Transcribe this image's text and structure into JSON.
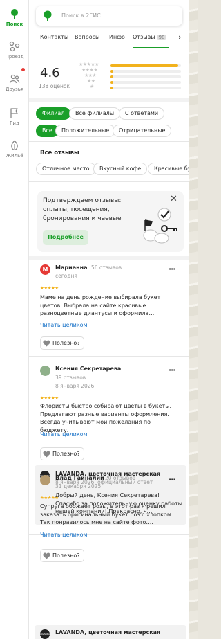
{
  "rail": {
    "items": [
      {
        "label": "Поиск",
        "icon": "search-pin-icon",
        "active": true
      },
      {
        "label": "Проезд",
        "icon": "route-icon"
      },
      {
        "label": "Друзья",
        "icon": "friends-icon"
      },
      {
        "label": "Гид",
        "icon": "guide-flag-icon"
      },
      {
        "label": "Жильё",
        "icon": "housing-icon"
      }
    ]
  },
  "search": {
    "placeholder": "Поиск в 2ГИС"
  },
  "tabs": {
    "items": [
      "Контакты",
      "Вопросы",
      "Инфо",
      "Отзывы"
    ],
    "active": "Отзывы",
    "reviews_badge": "98"
  },
  "rating": {
    "value": "4.6",
    "count_label": "138 оценок",
    "distribution": [
      0.96,
      0.04,
      0.03,
      0.02,
      0.04
    ]
  },
  "filters": {
    "scope": [
      "Филиал",
      "Все филиалы",
      "С ответами"
    ],
    "scope_active": "Филиал",
    "sentiment": [
      "Все",
      "Положительные",
      "Отрицательные"
    ],
    "sentiment_active": "Все"
  },
  "all_reviews": {
    "title": "Все отзывы",
    "tags": [
      "Отличное место",
      "Вкусный кофе",
      "Красивые бук"
    ]
  },
  "promo": {
    "text": "Подтверждаем отзывы: оплаты, посещения, бронирования и чаевые",
    "button": "Подробнее"
  },
  "reviews": [
    {
      "author": "Марианна",
      "initial": "М",
      "count": "56 отзывов",
      "date": "сегодня",
      "stars": 5,
      "text": "Маме на день рождение выбирала букет цветов. Выбрала на сайте красивые разноцветные диантусы и оформила…",
      "read_more": "Читать целиком",
      "useful": "Полезно?"
    },
    {
      "author": "Ксения Секретарева",
      "count": "39 отзывов",
      "date": "8 января 2026",
      "stars": 5,
      "text": "Флористы быстро собирают цветы в букеты. Предлагают разные варианты оформления. Всегда учитывают мои пожелания по бюджету.",
      "read_more": "Читать целиком",
      "useful": "Полезно?",
      "reply": {
        "author": "LAVANDA, цветочная мастерская",
        "meta": "8 января 2026, официальный ответ",
        "text": "Добрый день, Ксения Секретарева! Спасибо за положительную оценку работы нашей компании! Прекрасно, ч…",
        "logo_text": "LAVANDA"
      }
    },
    {
      "author": "Влад Гайналий",
      "count": "20 отзывов",
      "date": "31 декабря 2025",
      "stars": 5,
      "text": "Супруга обожает розы, в этот раз я решил заказать оригинальный букет роз с хлопком. Так понравилось мне на сайте фото….",
      "read_more": "Читать целиком",
      "useful": "Полезно?",
      "reply": {
        "author": "LAVANDA, цветочная мастерская",
        "logo_text": "LAVANDA"
      }
    }
  ],
  "colors": {
    "accent": "#1a9f29",
    "star": "#f2b21c",
    "link": "#1a73c8"
  }
}
